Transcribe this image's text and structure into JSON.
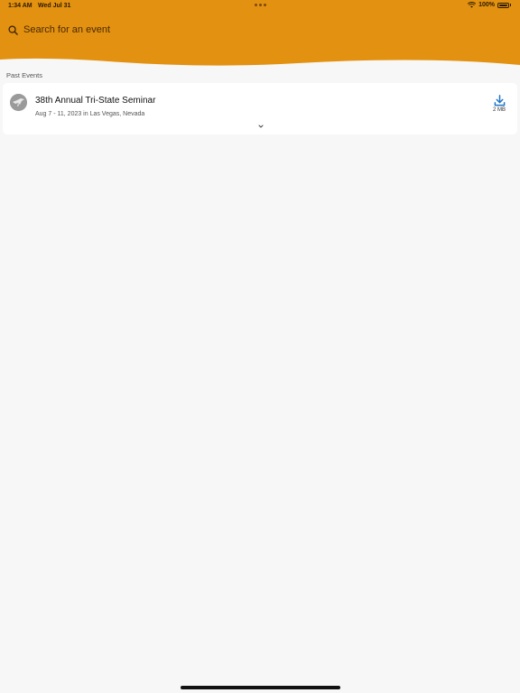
{
  "status_bar": {
    "time": "1:34 AM",
    "date": "Wed Jul 31",
    "battery": "100%"
  },
  "header": {
    "background_color": "#e39110",
    "search_placeholder": "Search for an event"
  },
  "past_events": {
    "section_title": "Past Events",
    "items": [
      {
        "title": "38th Annual Tri-State Seminar",
        "subtitle": "Aug 7 - 11, 2023 in Las Vegas, Nevada",
        "download_size": "2 MB",
        "download_icon_color": "#1e73c8"
      }
    ]
  },
  "icons": {
    "search": "search-icon",
    "wifi": "wifi-icon",
    "battery": "battery-icon",
    "download": "download-icon",
    "expand": "chevron-down-icon",
    "event_logo": "event-logo-icon"
  }
}
